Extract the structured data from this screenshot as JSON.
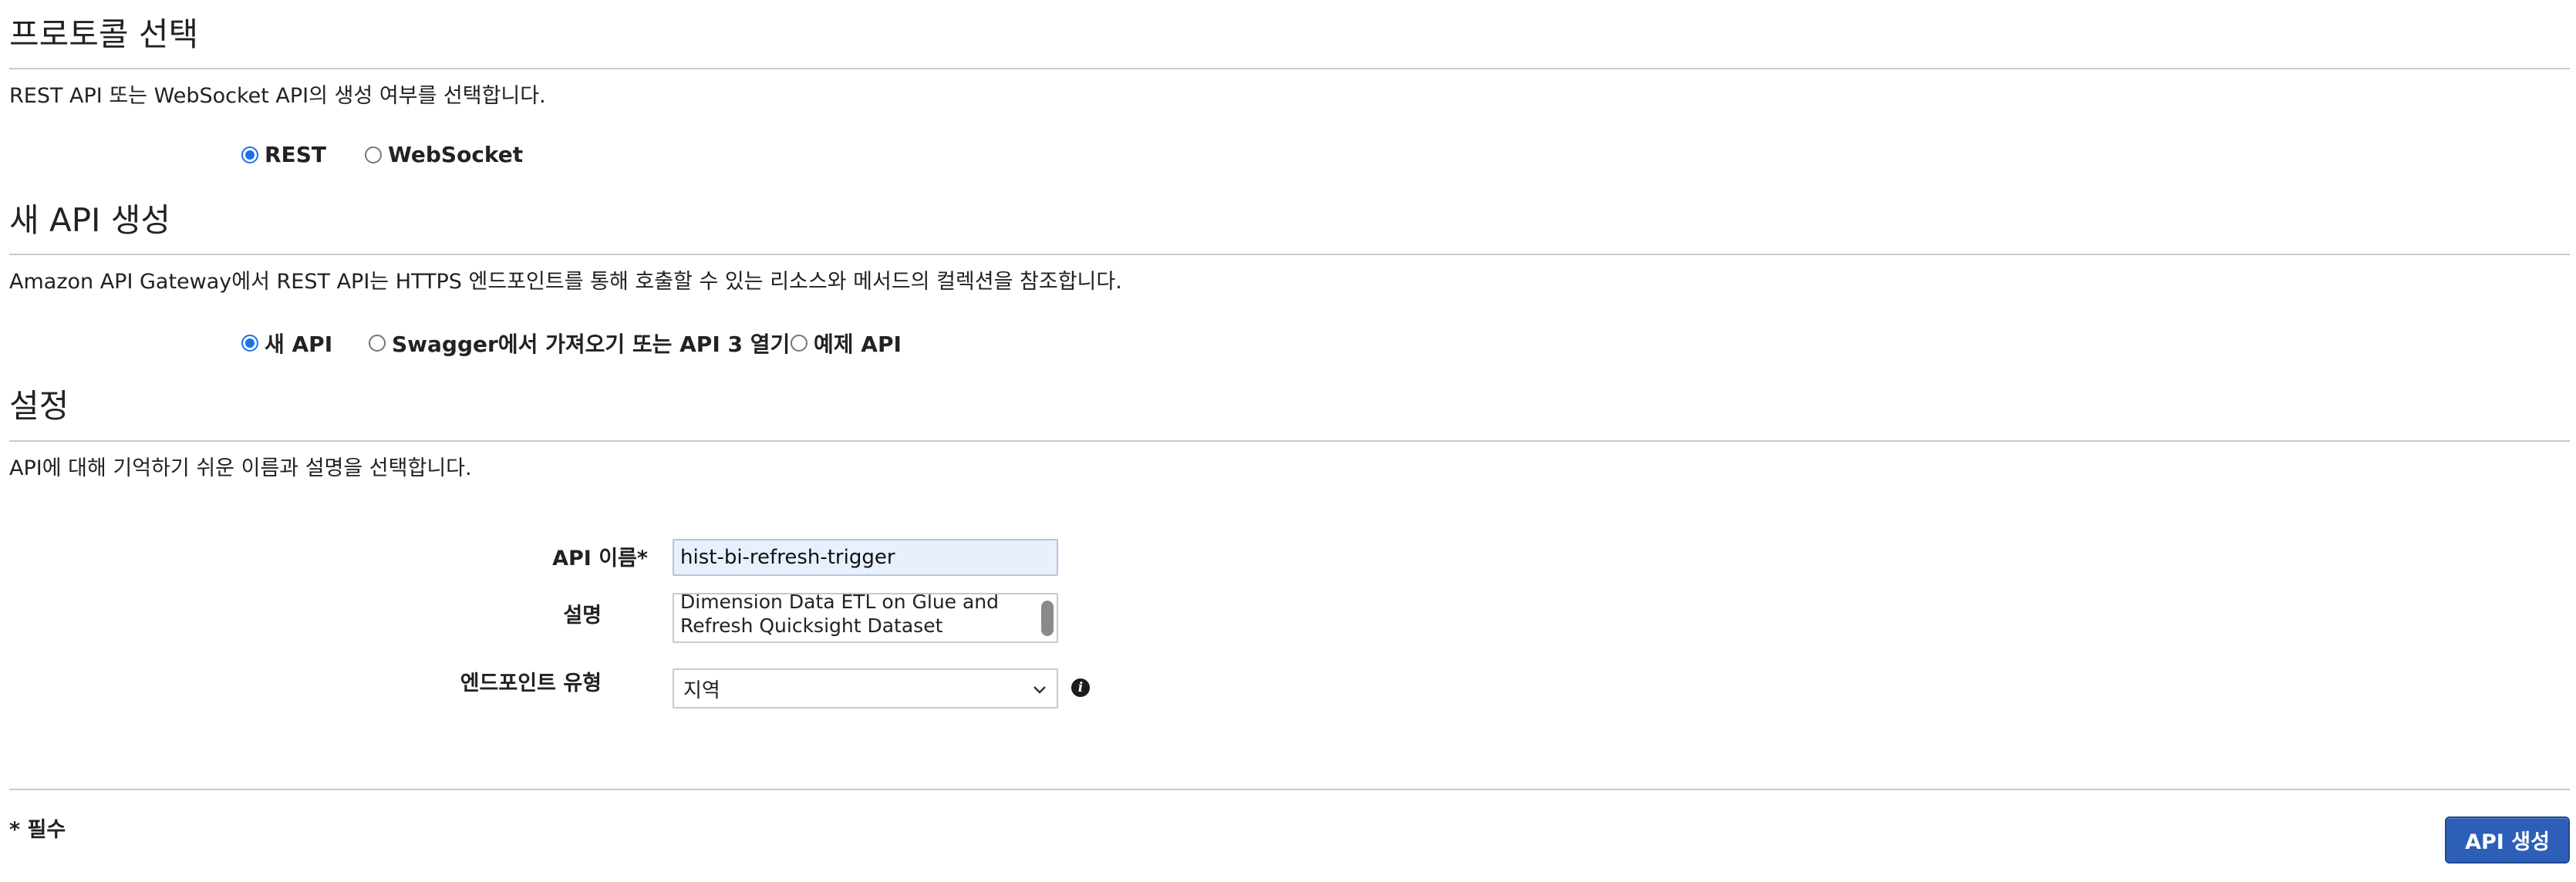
{
  "protocol_section": {
    "title": "프로토콜 선택",
    "description": "REST API 또는 WebSocket API의 생성 여부를 선택합니다.",
    "options": [
      {
        "label": "REST",
        "checked": true
      },
      {
        "label": "WebSocket",
        "checked": false
      }
    ]
  },
  "create_section": {
    "title": "새 API 생성",
    "description": "Amazon API Gateway에서 REST API는 HTTPS 엔드포인트를 통해 호출할 수 있는 리소스와 메서드의 컬렉션을 참조합니다.",
    "options": [
      {
        "label": "새 API",
        "checked": true
      },
      {
        "label": "Swagger에서 가져오기 또는 API 3 열기",
        "checked": false
      },
      {
        "label": "예제 API",
        "checked": false
      }
    ]
  },
  "settings_section": {
    "title": "설정",
    "description": "API에 대해 기억하기 쉬운 이름과 설명을 선택합니다.",
    "fields": {
      "api_name_label": "API 이름*",
      "api_name_value": "hist-bi-refresh-trigger",
      "description_label": "설명",
      "description_lines": [
        "Dimension Data ETL on Glue and",
        "Refresh Quicksight Dataset"
      ],
      "endpoint_label": "엔드포인트 유형",
      "endpoint_value": "지역"
    },
    "info_icon": "info-icon",
    "chevron_icon": "chevron-down-icon"
  },
  "footer": {
    "required_note": "* 필수",
    "create_button": "API 생성"
  },
  "colors": {
    "radio_accent": "#1a73e8",
    "button": "#2d5fb8",
    "input_autofill": "#e8f0fe",
    "divider": "#c9c9c9"
  }
}
